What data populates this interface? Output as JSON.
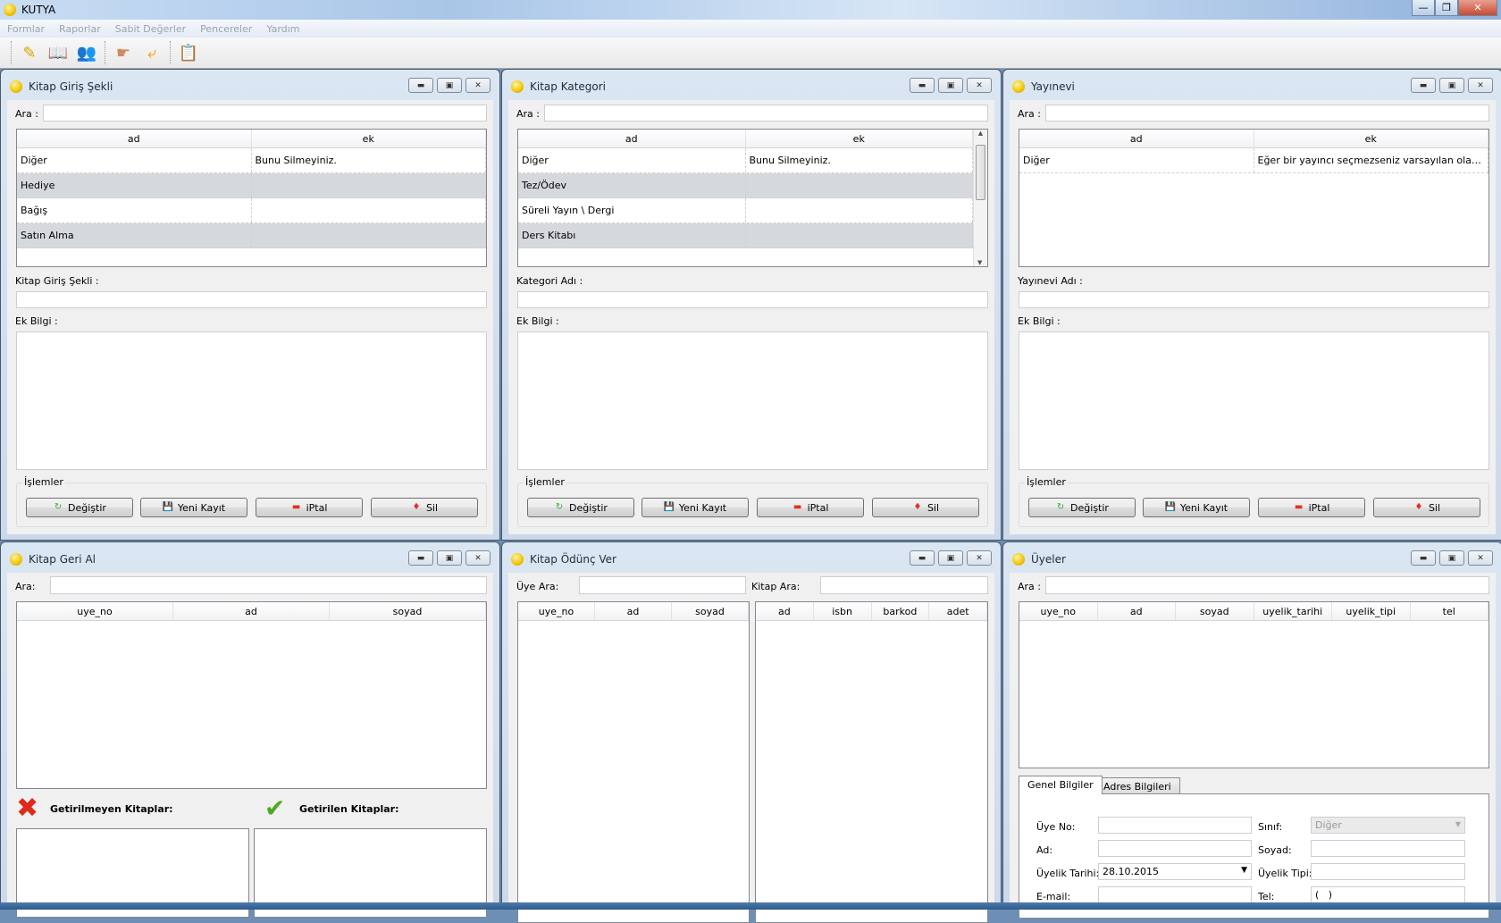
{
  "app": {
    "title": "KUTYA"
  },
  "menu": [
    "Formlar",
    "Raporlar",
    "Sabit Değerler",
    "Pencereler",
    "Yardım"
  ],
  "toolbar": {
    "icons": [
      "new-entry-icon",
      "book-icon",
      "members-icon",
      "lend-hand-icon",
      "return-arrow-icon",
      "card-icon"
    ]
  },
  "common": {
    "search": "Ara :",
    "ek_bilgi": "Ek Bilgi :",
    "islemler": "İşlemler",
    "degistir": "Değiştir",
    "yeni": "Yeni Kayıt",
    "iptal": "iPtal",
    "sil": "Sil",
    "col_ad": "ad",
    "col_ek": "ek"
  },
  "giris": {
    "title": "Kitap Giriş Şekli",
    "field": "Kitap Giriş Şekli :",
    "rows": [
      [
        "Diğer",
        "Bunu Silmeyiniz."
      ],
      [
        "Hediye",
        ""
      ],
      [
        "Bağış",
        ""
      ],
      [
        "Satın Alma",
        ""
      ]
    ]
  },
  "kategori": {
    "title": "Kitap Kategori",
    "field": "Kategori Adı :",
    "rows": [
      [
        "Diğer",
        "Bunu Silmeyiniz."
      ],
      [
        "Tez/Ödev",
        ""
      ],
      [
        "Süreli Yayın \\ Dergi",
        ""
      ],
      [
        "Ders Kitabı",
        ""
      ]
    ]
  },
  "yayinevi": {
    "title": "Yayınevi",
    "field": "Yayınevi Adı :",
    "rows": [
      [
        "Diğer",
        "Eğer bir yayıncı seçmezseniz varsayılan olarak ..."
      ]
    ]
  },
  "geri": {
    "title": "Kitap Geri Al",
    "search": "Ara:",
    "cols": [
      "uye_no",
      "ad",
      "soyad"
    ],
    "not_returned": "Getirilmeyen Kitaplar:",
    "returned": "Getirilen Kitaplar:"
  },
  "odunc": {
    "title": "Kitap Ödünç Ver",
    "member_search": "Üye Ara:",
    "book_search": "Kitap Ara:",
    "member_cols": [
      "uye_no",
      "ad",
      "soyad"
    ],
    "book_cols": [
      "ad",
      "isbn",
      "barkod",
      "adet"
    ]
  },
  "uyeler": {
    "title": "Üyeler",
    "search": "Ara :",
    "cols": [
      "uye_no",
      "ad",
      "soyad",
      "uyelik_tarihi",
      "uyelik_tipi",
      "tel"
    ],
    "tabs": [
      "Genel Bilgiler",
      "Adres Bilgileri"
    ],
    "form": {
      "uye_no": "Üye No:",
      "ad": "Ad:",
      "uyelik_tarihi": "Üyelik Tarihi:",
      "email": "E-mail:",
      "sinif": "Sınıf:",
      "soyad": "Soyad:",
      "uyelik_tipi": "Üyelik Tipi:",
      "tel": "Tel:"
    },
    "values": {
      "uyelik_tarihi": "28.10.2015",
      "sinif": "Diğer",
      "tel": "(   )"
    }
  }
}
